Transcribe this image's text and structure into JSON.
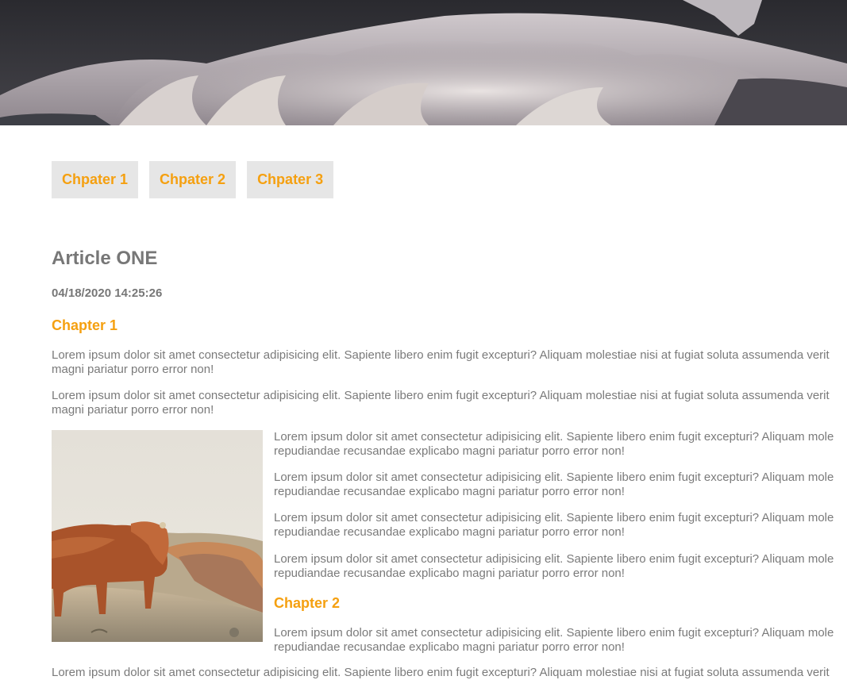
{
  "hero": {
    "alt": "hero-image-crashing-waves"
  },
  "nav": {
    "items": [
      {
        "label": "Chpater 1"
      },
      {
        "label": "Chpater 2"
      },
      {
        "label": "Chpater 3"
      }
    ]
  },
  "article": {
    "title": "Article ONE",
    "date": "04/18/2020 14:25:26",
    "chapter1": {
      "title": "Chapter 1",
      "para1_line1": "Lorem ipsum dolor sit amet consectetur adipisicing elit. Sapiente libero enim fugit excepturi? Aliquam molestiae nisi at fugiat soluta assumenda verit",
      "para1_line2": "magni pariatur porro error non!",
      "para2_line1": "Lorem ipsum dolor sit amet consectetur adipisicing elit. Sapiente libero enim fugit excepturi? Aliquam molestiae nisi at fugiat soluta assumenda verit",
      "para2_line2": "magni pariatur porro error non!"
    },
    "side_paragraphs": [
      {
        "line1": "Lorem ipsum dolor sit amet consectetur adipisicing elit. Sapiente libero enim fugit excepturi? Aliquam mole",
        "line2": "repudiandae recusandae explicabo magni pariatur porro error non!"
      },
      {
        "line1": "Lorem ipsum dolor sit amet consectetur adipisicing elit. Sapiente libero enim fugit excepturi? Aliquam mole",
        "line2": "repudiandae recusandae explicabo magni pariatur porro error non!"
      },
      {
        "line1": "Lorem ipsum dolor sit amet consectetur adipisicing elit. Sapiente libero enim fugit excepturi? Aliquam mole",
        "line2": "repudiandae recusandae explicabo magni pariatur porro error non!"
      },
      {
        "line1": "Lorem ipsum dolor sit amet consectetur adipisicing elit. Sapiente libero enim fugit excepturi? Aliquam mole",
        "line2": "repudiandae recusandae explicabo magni pariatur porro error non!"
      }
    ],
    "chapter2": {
      "title": "Chapter 2",
      "para1_line1": "Lorem ipsum dolor sit amet consectetur adipisicing elit. Sapiente libero enim fugit excepturi? Aliquam mole",
      "para1_line2": "repudiandae recusandae explicabo magni pariatur porro error non!",
      "para2_line1": "Lorem ipsum dolor sit amet consectetur adipisicing elit. Sapiente libero enim fugit excepturi? Aliquam molestiae nisi at fugiat soluta assumenda verit"
    },
    "image": {
      "alt": "highland-cow-photo"
    }
  },
  "colors": {
    "accent": "#f5a010",
    "text": "#7a7a7a",
    "nav_bg": "#e6e6e6"
  }
}
